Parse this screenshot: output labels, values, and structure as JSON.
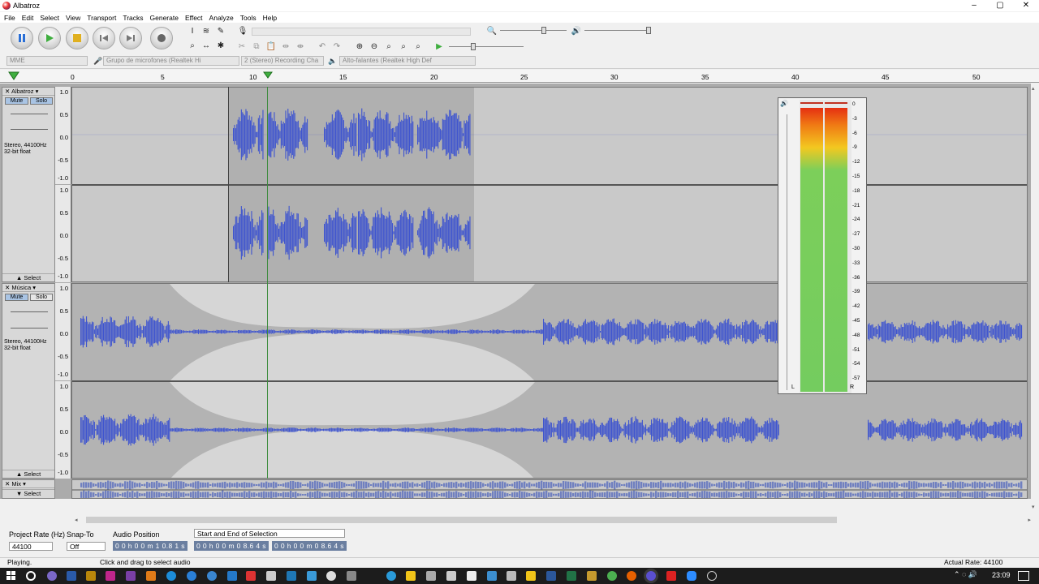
{
  "window": {
    "title": "Albatroz",
    "minimize": "–",
    "maximize": "▢",
    "close": "✕"
  },
  "menu": [
    "File",
    "Edit",
    "Select",
    "View",
    "Transport",
    "Tracks",
    "Generate",
    "Effect",
    "Analyze",
    "Tools",
    "Help"
  ],
  "toolbar": {
    "host": "MME",
    "mic_device": "Grupo de microfones (Realtek Hi",
    "channels": "2 (Stereo) Recording Cha",
    "playback_device": "Alto-falantes (Realtek High Def"
  },
  "ruler": {
    "ticks": [
      "0",
      "5",
      "10",
      "15",
      "20",
      "25",
      "30",
      "35",
      "40",
      "45",
      "50"
    ]
  },
  "tracks": [
    {
      "name": "Albatroz",
      "mute": "Mute",
      "solo": "Solo",
      "info": "Stereo, 44100Hz 32-bit float",
      "select": "Select"
    },
    {
      "name": "Música",
      "mute": "Mute",
      "solo": "Solo",
      "info": "Stereo, 44100Hz 32-bit float",
      "select": "Select"
    },
    {
      "name": "Mix",
      "select": "Select"
    }
  ],
  "scale_labels": [
    "1.0",
    "0.5",
    "0.0",
    "-0.5",
    "-1.0"
  ],
  "meter": {
    "labels": [
      "0",
      "-3",
      "-6",
      "-9",
      "-12",
      "-15",
      "-18",
      "-21",
      "-24",
      "-27",
      "-30",
      "-33",
      "-36",
      "-39",
      "-42",
      "-45",
      "-48",
      "-51",
      "-54",
      "-57"
    ],
    "left": "L",
    "right": "R"
  },
  "selection_bar": {
    "project_rate_label": "Project Rate (Hz)",
    "project_rate": "44100",
    "snap_label": "Snap-To",
    "snap": "Off",
    "audio_position_label": "Audio Position",
    "audio_position": "0 0 h 0 0 m 1 0.8 1 s",
    "selection_mode": "Start and End of Selection",
    "sel_start": "0 0 h 0 0 m 0 8.6 4 s",
    "sel_end": "0 0 h 0 0 m 0 8.6 4 s"
  },
  "status": {
    "state": "Playing.",
    "hint": "Click and drag to select audio",
    "rate": "Actual Rate: 44100"
  },
  "taskbar": {
    "time": "23:09"
  }
}
